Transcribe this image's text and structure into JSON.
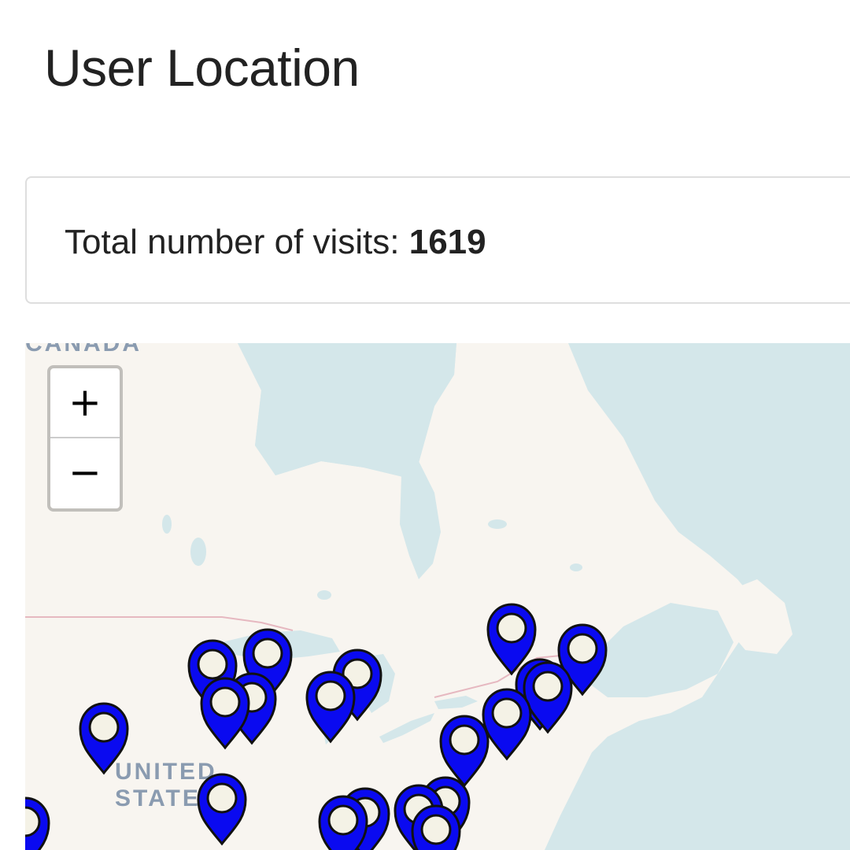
{
  "page": {
    "title": "User Location"
  },
  "stats": {
    "label": "Total number of visits:",
    "value": "1619"
  },
  "map": {
    "zoom_in_label": "+",
    "zoom_out_label": "−",
    "country_labels": {
      "canada": "CANADA",
      "united_states_line1": "UNITED",
      "united_states_line2": "STATES"
    },
    "colors": {
      "water": "#d4e7ea",
      "land": "#f8f5f0",
      "marker_fill": "#0a0af0",
      "marker_outline": "#111111",
      "marker_center": "#f4f2e6",
      "border": "#e6b8c0"
    }
  }
}
